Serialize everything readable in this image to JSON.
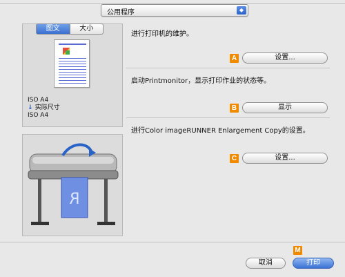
{
  "dropdown": {
    "value": "公用程序"
  },
  "preview": {
    "tabs": [
      "图文",
      "大小"
    ],
    "paper_from": "ISO A4",
    "scale_label": "实际尺寸",
    "paper_to": "ISO A4"
  },
  "sections": [
    {
      "text": "进行打印机的维护。",
      "badge": "A",
      "button": "设置..."
    },
    {
      "text": "启动Printmonitor，显示打印作业的状态等。",
      "badge": "B",
      "button": "显示"
    },
    {
      "text": "进行Color imageRUNNER Enlargement Copy的设置。",
      "badge": "C",
      "button": "设置..."
    }
  ],
  "footer": {
    "badge": "M",
    "cancel": "取消",
    "print": "打印"
  },
  "colors": {
    "badge": "#f28a00",
    "accent": "#3a72d6"
  }
}
